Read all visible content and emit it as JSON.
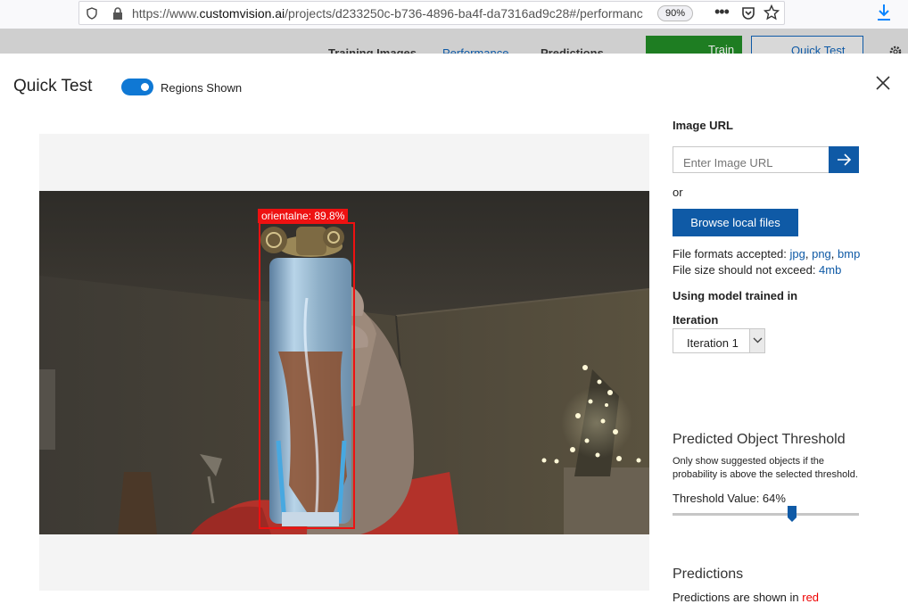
{
  "browser": {
    "url_prefix": "https://www.",
    "url_domain": "customvision.ai",
    "url_rest": "/projects/d233250c-b736-4896-ba4f-da7316ad9c28#/performanc",
    "zoom": "90%",
    "more": "•••"
  },
  "app_header": {
    "tabs": [
      "Training Images",
      "Performance",
      "Predictions"
    ],
    "train_label": "Train",
    "quick_test_label": "Quick Test"
  },
  "modal": {
    "title": "Quick Test",
    "toggle_label": "Regions Shown",
    "toggle_on": true
  },
  "detection": {
    "label": "orientalne: 89.8%",
    "color": "#ee1111"
  },
  "sidebar": {
    "image_url_label": "Image URL",
    "image_url_placeholder": "Enter Image URL",
    "or_text": "or",
    "browse_label": "Browse local files",
    "formats_prefix": "File formats accepted: ",
    "formats": [
      "jpg",
      "png",
      "bmp"
    ],
    "size_prefix": "File size should not exceed: ",
    "size_value": "4mb",
    "model_label": "Using model trained in",
    "iteration_label": "Iteration",
    "iteration_value": "Iteration 1",
    "threshold_title": "Predicted Object Threshold",
    "threshold_desc": "Only show suggested objects if the probability is above the selected threshold.",
    "threshold_value_label": "Threshold Value: 64%",
    "threshold_fraction": 0.64,
    "predictions_title": "Predictions",
    "predictions_prefix": "Predictions are shown in ",
    "predictions_color_word": "red"
  },
  "colors": {
    "accent": "#0f5aa6",
    "toggle": "#0f78d4",
    "train_green": "#1e7d22",
    "region_red": "#ee1111"
  }
}
